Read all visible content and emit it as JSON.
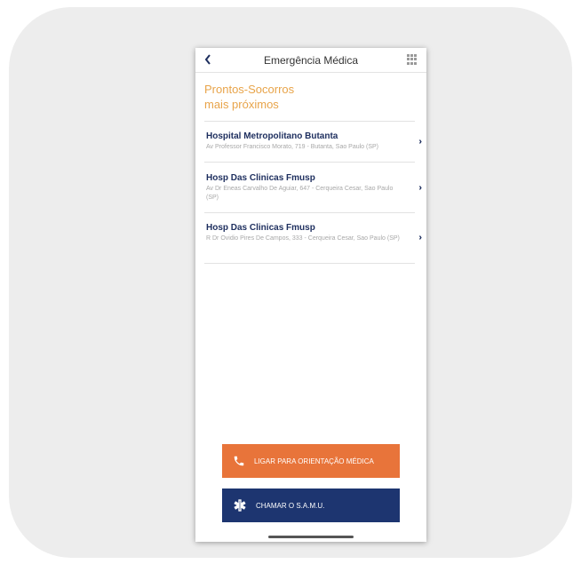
{
  "header": {
    "title": "Emergência Médica",
    "back_icon": "chevron-left-icon",
    "menu_icon": "grid-icon"
  },
  "section": {
    "title_line1": "Prontos-Socorros",
    "title_line2": "mais próximos"
  },
  "hospitals": [
    {
      "name": "Hospital Metropolitano Butanta",
      "address": "Av Professor Francisco Morato, 719 - Butanta, Sao Paulo (SP)"
    },
    {
      "name": "Hosp Das Clinicas Fmusp",
      "address": "Av Dr Eneas Carvalho De Aguiar, 647 - Cerqueira Cesar, Sao Paulo (SP)"
    },
    {
      "name": "Hosp Das Clinicas Fmusp",
      "address": "R Dr Ovidio Pires De Campos, 333 - Cerqueira Cesar, Sao Paulo (SP)"
    }
  ],
  "buttons": {
    "call_label": "LIGAR PARA ORIENTAÇÃO MÉDICA",
    "samu_label": "CHAMAR O S.A.M.U."
  },
  "colors": {
    "accent_orange": "#e8743a",
    "title_orange": "#e8a44a",
    "navy": "#1d3570",
    "name_navy": "#1d2e5e"
  }
}
